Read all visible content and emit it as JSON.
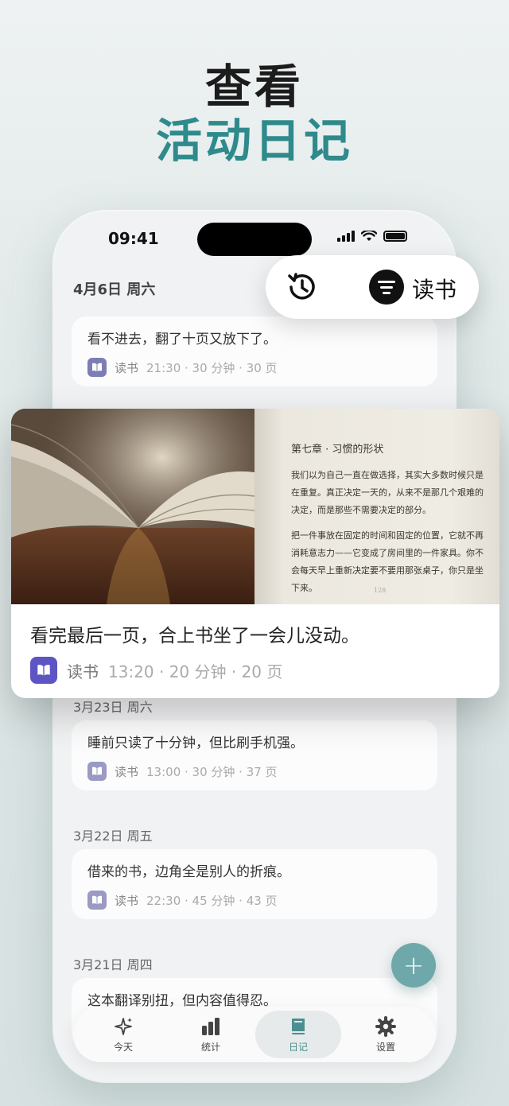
{
  "hero": {
    "line1": "查看",
    "line2": "活动日记"
  },
  "status": {
    "time": "09:41"
  },
  "filter_pill": {
    "category": "读书"
  },
  "days": [
    {
      "date": "4月6日 周六",
      "entry": {
        "text": "看不进去，翻了十页又放下了。",
        "category": "读书",
        "meta": "21:30 · 30 分钟 · 30 页"
      }
    },
    {
      "date": "3月23日 周六",
      "entry": {
        "text": "睡前只读了十分钟，但比刷手机强。",
        "category": "读书",
        "meta": "13:00 · 30 分钟 · 37 页"
      }
    },
    {
      "date": "3月22日 周五",
      "entry": {
        "text": "借来的书，边角全是别人的折痕。",
        "category": "读书",
        "meta": "22:30 · 45 分钟 · 43 页"
      }
    },
    {
      "date": "3月21日 周四",
      "entry": {
        "text": "这本翻译别扭，但内容值得忍。"
      }
    }
  ],
  "featured": {
    "page_title": "第七章 · 习惯的形状",
    "page_p1": "我们以为自己一直在做选择，其实大多数时候只是在重复。真正决定一天的，从来不是那几个艰难的决定，而是那些不需要决定的部分。",
    "page_p2": "把一件事放在固定的时间和固定的位置，它就不再消耗意志力——它变成了房间里的一件家具。你不会每天早上重新决定要不要用那张桌子，你只是坐下来。",
    "page_num": "128",
    "text": "看完最后一页，合上书坐了一会儿没动。",
    "category": "读书",
    "meta": "13:20 · 20 分钟 · 20 页"
  },
  "fab": "+",
  "tabs": [
    {
      "label": "今天",
      "icon": "sparkle-icon"
    },
    {
      "label": "统计",
      "icon": "bar-chart-icon"
    },
    {
      "label": "日记",
      "icon": "book-icon",
      "active": true
    },
    {
      "label": "设置",
      "icon": "gear-icon"
    }
  ],
  "colors": {
    "accent": "#2f8a8c",
    "book_badge": "#5d55c4",
    "fab": "#6fa8aa"
  }
}
